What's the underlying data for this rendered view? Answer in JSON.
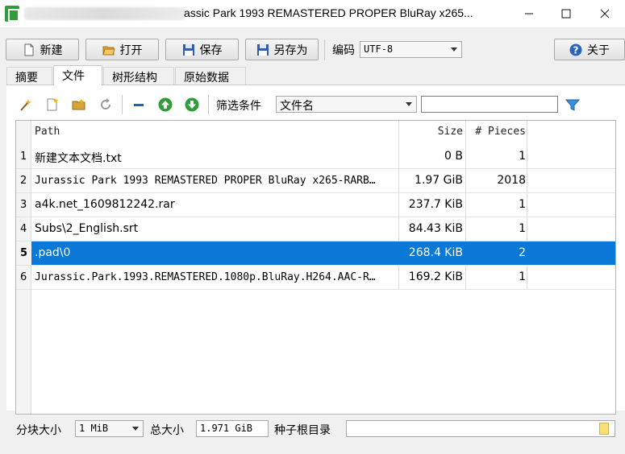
{
  "window": {
    "title": "assic Park 1993 REMASTERED PROPER BluRay x265..."
  },
  "toolbar": {
    "new_label": "新建",
    "open_label": "打开",
    "save_label": "保存",
    "saveas_label": "另存为",
    "encoding_label": "编码",
    "encoding_value": "UTF-8",
    "about_label": "关于"
  },
  "tabs": [
    {
      "label": "摘要"
    },
    {
      "label": "文件"
    },
    {
      "label": "树形结构"
    },
    {
      "label": "原始数据"
    }
  ],
  "filter": {
    "label": "筛选条件",
    "field_value": "文件名",
    "search_value": ""
  },
  "table": {
    "columns": {
      "path": "Path",
      "size": "Size",
      "pieces": "# Pieces"
    },
    "rows": [
      {
        "num": "1",
        "path": "新建文本文档.txt",
        "size": "0 B",
        "pieces": "1"
      },
      {
        "num": "2",
        "path": "Jurassic Park 1993 REMASTERED PROPER BluRay x265-RARB…",
        "size": "1.97 GiB",
        "pieces": "2018"
      },
      {
        "num": "3",
        "path": "a4k.net_1609812242.rar",
        "size": "237.7 KiB",
        "pieces": "1"
      },
      {
        "num": "4",
        "path": "Subs\\2_English.srt",
        "size": "84.43 KiB",
        "pieces": "1"
      },
      {
        "num": "5",
        "path": ".pad\\0",
        "size": "268.4 KiB",
        "pieces": "2"
      },
      {
        "num": "6",
        "path": "Jurassic.Park.1993.REMASTERED.1080p.BluRay.H264.AAC-R…",
        "size": "169.2 KiB",
        "pieces": "1"
      }
    ],
    "selected_row": 5
  },
  "bottom": {
    "block_size_label": "分块大小",
    "block_size_value": "1 MiB",
    "total_size_label": "总大小",
    "total_size_value": "1.971 GiB",
    "root_dir_label": "种子根目录",
    "root_dir_value": ""
  },
  "colors": {
    "selection": "#0a78d7",
    "app_icon": "#2f9e3a",
    "green_arrow": "#2e9d3a",
    "filter_icon": "#3a8fd8"
  }
}
